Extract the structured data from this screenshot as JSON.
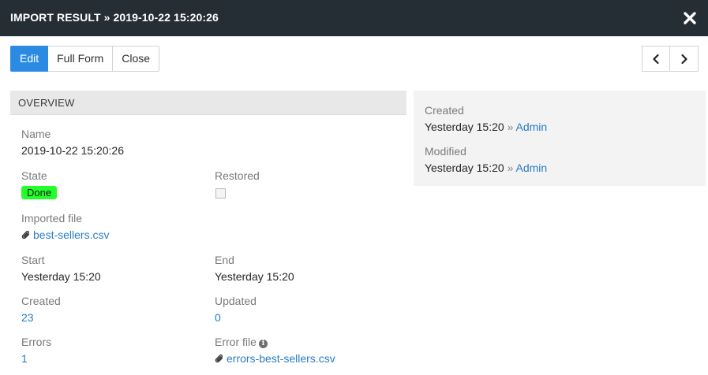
{
  "header": {
    "title": "IMPORT RESULT » 2019-10-22 15:20:26"
  },
  "toolbar": {
    "edit_label": "Edit",
    "full_form_label": "Full Form",
    "close_label": "Close"
  },
  "overview": {
    "section_title": "OVERVIEW",
    "name_label": "Name",
    "name_value": "2019-10-22 15:20:26",
    "state_label": "State",
    "state_value": "Done",
    "restored_label": "Restored",
    "imported_file_label": "Imported file",
    "imported_file_value": "best-sellers.csv",
    "start_label": "Start",
    "start_value": "Yesterday 15:20",
    "end_label": "End",
    "end_value": "Yesterday 15:20",
    "created_label": "Created",
    "created_value": "23",
    "updated_label": "Updated",
    "updated_value": "0",
    "errors_label": "Errors",
    "errors_value": "1",
    "error_file_label": "Error file",
    "error_file_value": "errors-best-sellers.csv"
  },
  "meta": {
    "created_label": "Created",
    "created_time": "Yesterday 15:20",
    "created_sep": "»",
    "created_by": "Admin",
    "modified_label": "Modified",
    "modified_time": "Yesterday 15:20",
    "modified_sep": "»",
    "modified_by": "Admin"
  },
  "colors": {
    "header_bg": "#262e35",
    "accent": "#2b8be3",
    "link": "#2a7cc2",
    "done_badge": "#22ff2a"
  }
}
